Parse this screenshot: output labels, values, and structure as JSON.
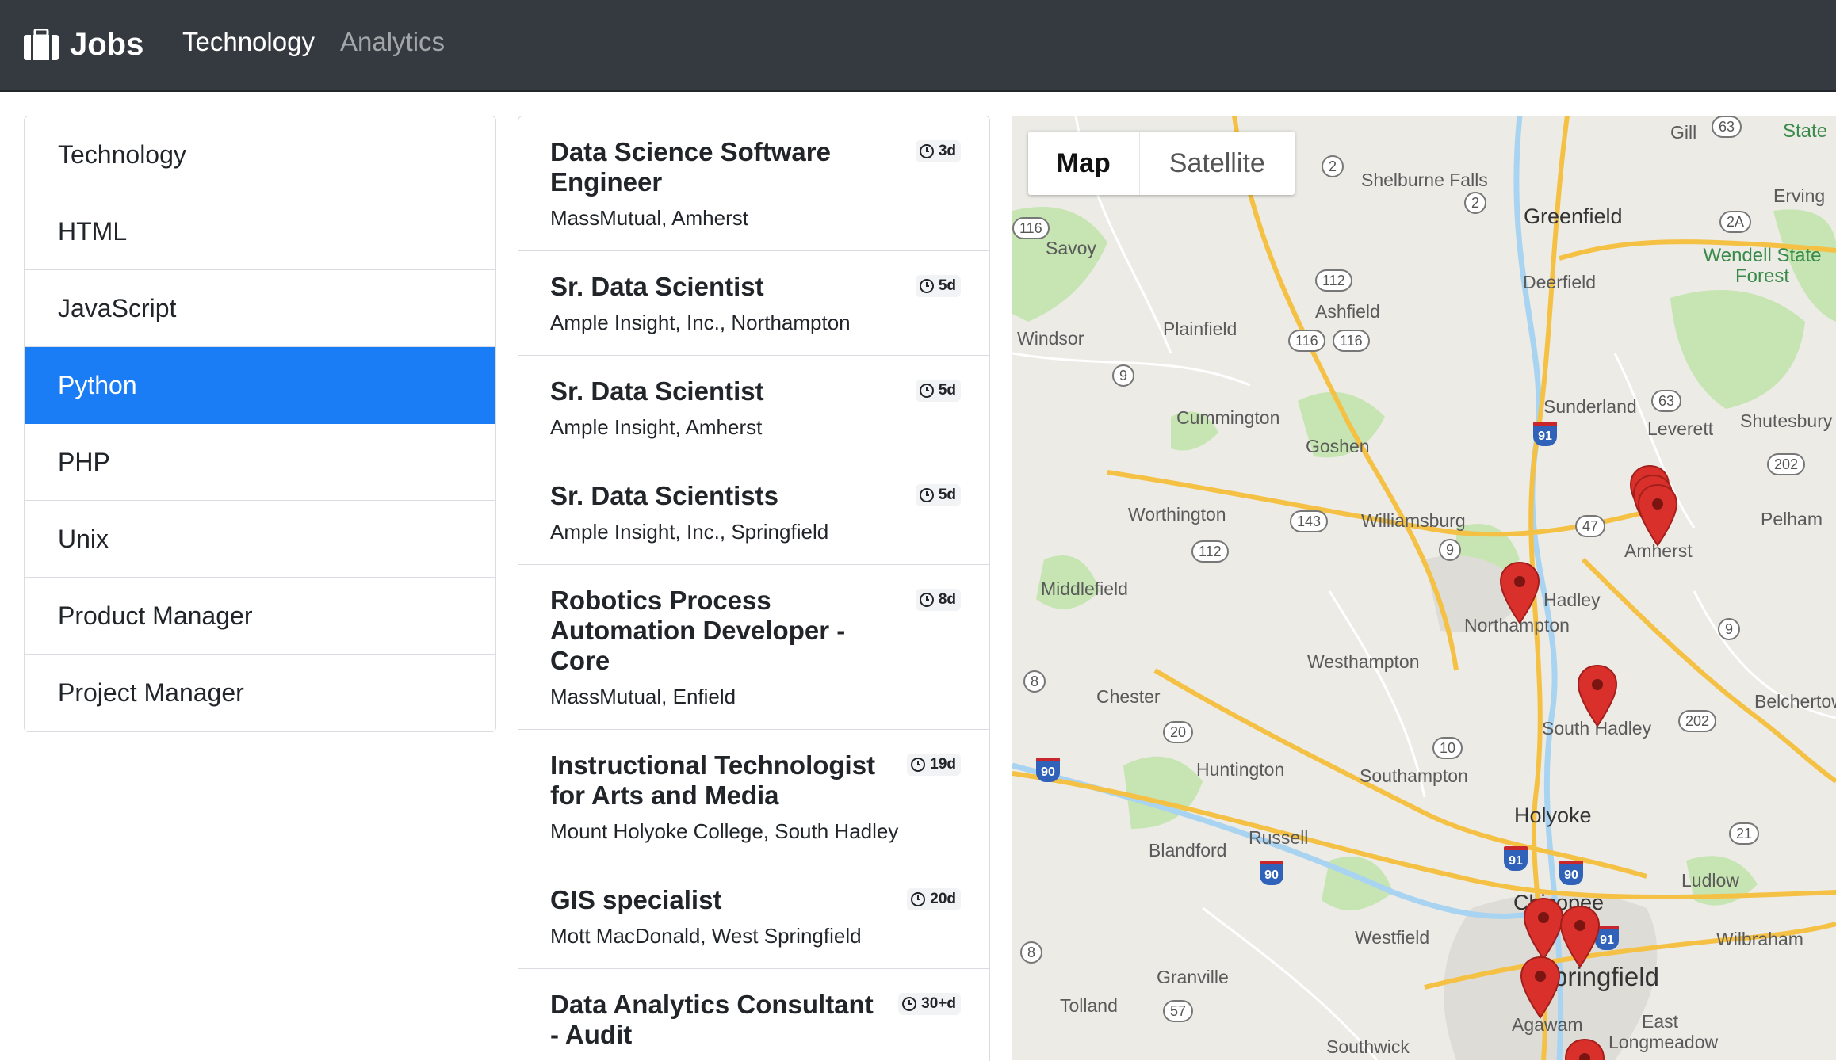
{
  "navbar": {
    "brand": "Jobs",
    "links": [
      "Technology",
      "Analytics"
    ]
  },
  "sidebar": {
    "items": [
      {
        "label": "Technology",
        "active": false
      },
      {
        "label": "HTML",
        "active": false
      },
      {
        "label": "JavaScript",
        "active": false
      },
      {
        "label": "Python",
        "active": true
      },
      {
        "label": "PHP",
        "active": false
      },
      {
        "label": "Unix",
        "active": false
      },
      {
        "label": "Product Manager",
        "active": false
      },
      {
        "label": "Project Manager",
        "active": false
      }
    ]
  },
  "jobs": [
    {
      "title": "Data Science Software Engineer",
      "company": "MassMutual, Amherst",
      "age": "3d"
    },
    {
      "title": "Sr. Data Scientist",
      "company": "Ample Insight, Inc., Northampton",
      "age": "5d"
    },
    {
      "title": "Sr. Data Scientist",
      "company": "Ample Insight, Amherst",
      "age": "5d"
    },
    {
      "title": "Sr. Data Scientists",
      "company": "Ample Insight, Inc., Springfield",
      "age": "5d"
    },
    {
      "title": "Robotics Process Automation Developer - Core",
      "company": "MassMutual, Enfield",
      "age": "8d"
    },
    {
      "title": "Instructional Technologist for Arts and Media",
      "company": "Mount Holyoke College, South Hadley",
      "age": "19d"
    },
    {
      "title": "GIS specialist",
      "company": "Mott MacDonald, West Springfield",
      "age": "20d"
    },
    {
      "title": "Data Analytics Consultant - Audit",
      "company": "",
      "age": "30+d"
    }
  ],
  "map": {
    "toggle": {
      "map": "Map",
      "satellite": "Satellite"
    },
    "towns": [
      "Shelburne Falls",
      "Greenfield",
      "Gill",
      "Erving",
      "Savoy",
      "Deerfield",
      "Wendell State Forest",
      "Windsor",
      "Plainfield",
      "Ashfield",
      "Cummington",
      "Goshen",
      "Sunderland",
      "Leverett",
      "Shutesbury",
      "Worthington",
      "Williamsburg",
      "Amherst",
      "Pelham",
      "Middlefield",
      "Hadley",
      "Northampton",
      "Westhampton",
      "Chester",
      "South Hadley",
      "Belchertown",
      "Huntington",
      "Southampton",
      "Holyoke",
      "Blandford",
      "Russell",
      "Ludlow",
      "Westfield",
      "Chicopee",
      "Springfield",
      "Wilbraham",
      "Granville",
      "Tolland",
      "Agawam",
      "East Longmeadow",
      "Southwick",
      "State"
    ],
    "colors": {
      "road": "#f5c144",
      "water": "#a8d4f2",
      "park": "#c6e5b2",
      "pin": "#d9302b"
    }
  },
  "colors": {
    "navbar": "#343a40",
    "active": "#1a7df5"
  }
}
